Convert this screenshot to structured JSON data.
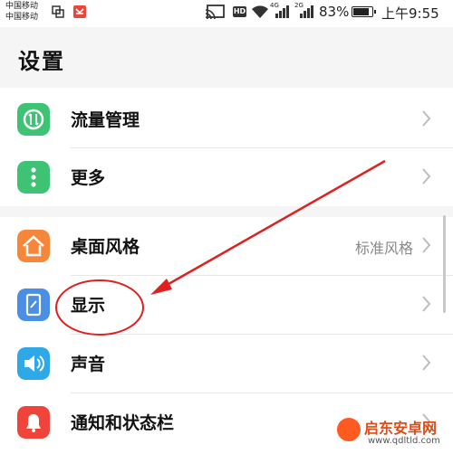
{
  "status_bar": {
    "carrier_1": "中国移动",
    "carrier_2": "中国移动",
    "signal_1_label": "4G",
    "signal_2_label": "2G",
    "battery": "83%",
    "time": "上午9:55",
    "hd_label": "HD"
  },
  "header": {
    "title": "设置"
  },
  "groups": [
    {
      "items": [
        {
          "label": "流量管理",
          "icon": "data-usage-icon",
          "color": "#3ec374"
        },
        {
          "label": "更多",
          "icon": "more-icon",
          "color": "#3ec374"
        }
      ]
    },
    {
      "items": [
        {
          "label": "桌面风格",
          "value": "标准风格",
          "icon": "home-icon",
          "color": "#f5863a"
        },
        {
          "label": "显示",
          "icon": "display-icon",
          "color": "#4a8fe3"
        },
        {
          "label": "声音",
          "icon": "sound-icon",
          "color": "#2fa8e8"
        },
        {
          "label": "通知和状态栏",
          "icon": "notification-icon",
          "color": "#f0443b"
        }
      ]
    }
  ],
  "annotation": {
    "color": "#e02020"
  },
  "watermark": {
    "name": "启东安卓网",
    "url": "www.qdltld.com"
  }
}
